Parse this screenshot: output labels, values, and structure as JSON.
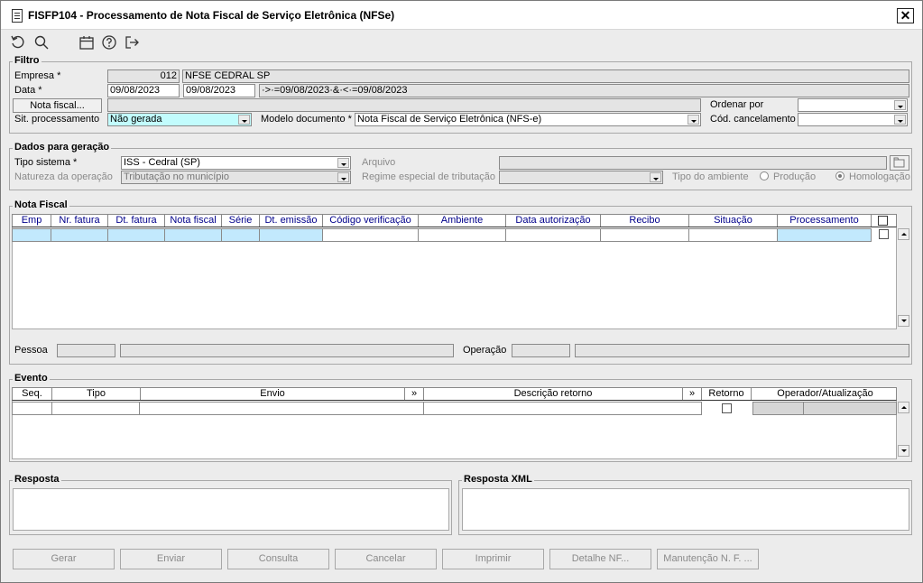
{
  "window": {
    "title": "FISFP104 - Processamento de Nota Fiscal de Serviço Eletrônica (NFSe)",
    "close": "✕"
  },
  "toolbar": {
    "icons": [
      "undo-icon",
      "search-icon",
      "calendar-icon",
      "help-icon",
      "exit-icon"
    ]
  },
  "filtro": {
    "title": "Filtro",
    "empresa_label": "Empresa *",
    "empresa_code": "012",
    "empresa_name": "NFSE CEDRAL SP",
    "data_label": "Data *",
    "data_from": "09/08/2023",
    "data_to": "09/08/2023",
    "data_expr": "·>·=09/08/2023·&·<·=09/08/2023",
    "nota_fiscal_button": "Nota fiscal...",
    "ordenar_label": "Ordenar por",
    "sit_label": "Sit. processamento",
    "sit_value": "Não gerada",
    "modelo_label": "Modelo documento *",
    "modelo_value": "Nota Fiscal de Serviço Eletrônica (NFS-e)",
    "cod_cancel_label": "Cód. cancelamento"
  },
  "dados": {
    "title": "Dados para geração",
    "tipo_label": "Tipo sistema *",
    "tipo_value": "ISS - Cedral (SP)",
    "arquivo_label": "Arquivo",
    "natureza_label": "Natureza da operação",
    "natureza_value": "Tributação no município",
    "regime_label": "Regime especial de tributação",
    "ambiente_label": "Tipo do ambiente",
    "producao_label": "Produção",
    "homologacao_label": "Homologação"
  },
  "nota": {
    "title": "Nota Fiscal",
    "columns": [
      "Emp",
      "Nr. fatura",
      "Dt. fatura",
      "Nota fiscal",
      "Série",
      "Dt. emissão",
      "Código verificação",
      "Ambiente",
      "Data autorização",
      "Recibo",
      "Situação",
      "Processamento"
    ],
    "pessoa_label": "Pessoa",
    "operacao_label": "Operação"
  },
  "evento": {
    "title": "Evento",
    "columns": [
      "Seq.",
      "Tipo",
      "Envio",
      "»",
      "Descrição retorno",
      "»",
      "Retorno",
      "Operador/Atualização"
    ]
  },
  "resposta": {
    "title": "Resposta"
  },
  "resposta_xml": {
    "title": "Resposta XML"
  },
  "footer": {
    "gerar": "Gerar",
    "enviar": "Enviar",
    "consulta": "Consulta",
    "cancelar": "Cancelar",
    "imprimir": "Imprimir",
    "detalhe": "Detalhe NF...",
    "manutencao": "Manutenção N. F. ..."
  }
}
